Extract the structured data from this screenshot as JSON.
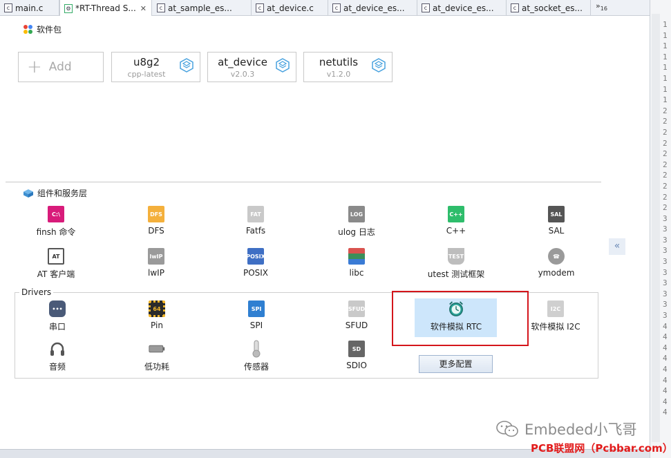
{
  "tabs": [
    {
      "label": "main.c",
      "icon": "c-file-icon",
      "active": false
    },
    {
      "label": "*RT-Thread S...",
      "icon": "settings-file-icon",
      "active": true
    },
    {
      "label": "at_sample_es...",
      "icon": "c-file-icon",
      "active": false
    },
    {
      "label": "at_device.c",
      "icon": "c-file-icon",
      "active": false
    },
    {
      "label": "at_device_es...",
      "icon": "c-file-icon",
      "active": false
    },
    {
      "label": "at_device_es...",
      "icon": "c-file-icon",
      "active": false
    },
    {
      "label": "at_socket_es...",
      "icon": "c-file-icon",
      "active": false
    }
  ],
  "tab_overflow": {
    "glyph": "»",
    "count": "16"
  },
  "packages": {
    "title": "软件包",
    "add_label": "Add",
    "items": [
      {
        "name": "u8g2",
        "version": "cpp-latest"
      },
      {
        "name": "at_device",
        "version": "v2.0.3"
      },
      {
        "name": "netutils",
        "version": "v1.2.0"
      }
    ]
  },
  "components": {
    "title": "组件和服务层",
    "items": [
      {
        "label": "finsh 命令",
        "icon": "terminal-icon",
        "color": "#d81b7a"
      },
      {
        "label": "DFS",
        "icon": "folder-icon",
        "color": "#f4b03c"
      },
      {
        "label": "Fatfs",
        "icon": "fat-file-icon",
        "color": "#c9c9c9"
      },
      {
        "label": "ulog 日志",
        "icon": "log-file-icon",
        "color": "#8a8a8a"
      },
      {
        "label": "C++",
        "icon": "cpp-file-icon",
        "color": "#2ebd6b"
      },
      {
        "label": "SAL",
        "icon": "router-icon",
        "color": "#555555"
      },
      {
        "label": "AT 客户端",
        "icon": "at-icon",
        "color": "#555555"
      },
      {
        "label": "lwIP",
        "icon": "network-icon",
        "color": "#9a9a9a"
      },
      {
        "label": "POSIX",
        "icon": "posix-file-icon",
        "color": "#3f6fc4"
      },
      {
        "label": "libc",
        "icon": "books-icon",
        "color": "#3b8f5a"
      },
      {
        "label": "utest 测试框架",
        "icon": "flask-icon",
        "color": "#bdbdbd"
      },
      {
        "label": "ymodem",
        "icon": "phone-icon",
        "color": "#9a9a9a"
      }
    ]
  },
  "drivers": {
    "title": "Drivers",
    "items": [
      {
        "label": "串口",
        "icon": "serial-port-icon",
        "color": "#4a5a78"
      },
      {
        "label": "Pin",
        "icon": "chip-icon",
        "color": "#f0b429"
      },
      {
        "label": "SPI",
        "icon": "spi-icon",
        "color": "#2f7fd1"
      },
      {
        "label": "SFUD",
        "icon": "flash-chip-icon",
        "color": "#c9c9c9"
      },
      {
        "label": "软件模拟 RTC",
        "icon": "alarm-clock-icon",
        "color": "#2aa197",
        "selected": true
      },
      {
        "label": "软件模拟 I2C",
        "icon": "i2c-chip-icon",
        "color": "#cfcfcf"
      },
      {
        "label": "音频",
        "icon": "headphones-icon",
        "color": "#555555"
      },
      {
        "label": "低功耗",
        "icon": "battery-icon",
        "color": "#777777"
      },
      {
        "label": "传感器",
        "icon": "thermometer-icon",
        "color": "#aaaaaa"
      },
      {
        "label": "SDIO",
        "icon": "sd-card-icon",
        "color": "#666666"
      }
    ],
    "more_button": "更多配置"
  },
  "collapse_glyph": "«",
  "line_numbers": [
    "1",
    "1",
    "1",
    "1",
    "1",
    "1",
    "1",
    "1",
    "2",
    "2",
    "2",
    "2",
    "2",
    "2",
    "2",
    "2",
    "2",
    "2",
    "3",
    "3",
    "3",
    "3",
    "3",
    "3",
    "3",
    "3",
    "3",
    "3",
    "4",
    "4",
    "4",
    "4",
    "4",
    "4",
    "4",
    "4",
    "4"
  ],
  "watermark": {
    "primary": "Embeded小飞哥",
    "secondary": "PCB联盟网（Pcbbar.com）"
  }
}
